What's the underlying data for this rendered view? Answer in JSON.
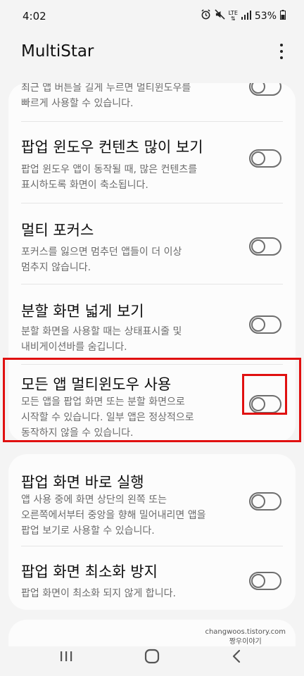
{
  "status": {
    "time": "4:02",
    "network": "LTE",
    "battery": "53%"
  },
  "app": {
    "title": "MultiStar",
    "menu_icon": "more-vertical-icon"
  },
  "settings": [
    {
      "title": "",
      "desc": "최근 앱 버튼을 길게 누르면 멀티윈도우를\n빠르게 사용할 수 있습니다.",
      "enabled": false
    },
    {
      "title": "팝업 윈도우 컨텐츠 많이 보기",
      "desc": "팝업 윈도우 앱이 동작될 때, 많은 컨텐츠를\n표시하도록 화면이 축소됩니다.",
      "enabled": false
    },
    {
      "title": "멀티 포커스",
      "desc": "포커스를 잃으면 멈추던 앱들이 더 이상\n멈추지 않습니다.",
      "enabled": false
    },
    {
      "title": "분할 화면 넓게 보기",
      "desc": "분할 화면을 사용할 때는 상태표시줄 및\n내비게이션바를 숨깁니다.",
      "enabled": false
    },
    {
      "title": "모든 앱 멀티윈도우 사용",
      "desc": "모든 앱을 팝업 화면 또는 분할 화면으로\n시작할 수 있습니다. 일부 앱은 정상적으로\n동작하지 않을 수 있습니다.",
      "enabled": false
    },
    {
      "title": "팝업 화면 바로 실행",
      "desc": "앱 사용 중에 화면 상단의 왼쪽 또는\n오른쪽에서부터 중앙을 향해 밀어내리면 앱을\n팝업 보기로 사용할 수 있습니다.",
      "enabled": false
    },
    {
      "title": "팝업 화면 최소화 방지",
      "desc": "팝업 화면이 최소화 되지 않게 합니다.",
      "enabled": false
    }
  ],
  "watermark": {
    "line1": "changwoos.tistory.com",
    "line2": "짱우이야기"
  },
  "navigation": {
    "recents_icon": "recents-icon",
    "home_icon": "home-icon",
    "back_icon": "back-icon"
  },
  "colors": {
    "highlight": "#e01010",
    "background": "#f4f4f4",
    "card": "#fcfcfc"
  }
}
